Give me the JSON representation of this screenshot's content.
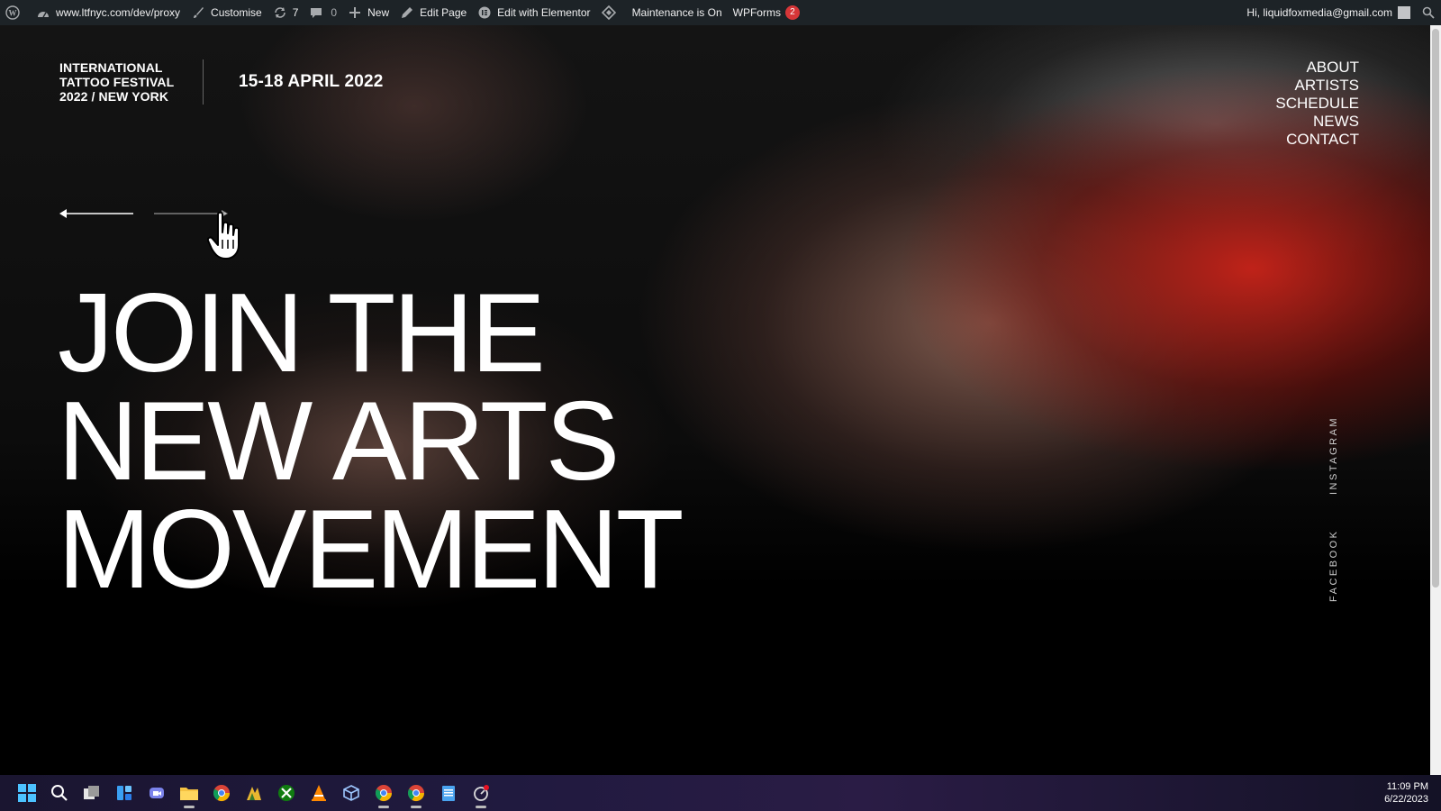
{
  "adminbar": {
    "wp_logo": "wordpress-icon",
    "site_url": "www.ltfnyc.com/dev/proxy",
    "customise": "Customise",
    "updates_count": "7",
    "comments_count": "0",
    "new": "New",
    "edit_page": "Edit Page",
    "edit_elementor": "Edit with Elementor",
    "maintenance": "Maintenance is On",
    "wpforms": "WPForms",
    "wpforms_badge": "2",
    "greeting": "Hi, liquidfoxmedia@gmail.com"
  },
  "site": {
    "logo_lines": [
      "INTERNATIONAL",
      "TATTOO FESTIVAL",
      "2022 / NEW YORK"
    ],
    "dates": "15-18 APRIL 2022",
    "nav": [
      "ABOUT",
      "ARTISTS",
      "SCHEDULE",
      "NEWS",
      "CONTACT"
    ],
    "headline": [
      "JOIN THE",
      "NEW ARTS",
      "MOVEMENT"
    ],
    "social": {
      "instagram": "INSTAGRAM",
      "facebook": "FACEBOOK"
    }
  },
  "taskbar": {
    "icons": [
      "windows-start-icon",
      "search-icon",
      "task-view-icon",
      "widgets-icon",
      "teams-chat-icon",
      "file-explorer-icon",
      "chrome-icon",
      "app-icon",
      "xbox-icon",
      "vlc-icon",
      "box-icon",
      "chrome-icon",
      "chrome-active-icon",
      "notepad-icon",
      "app-notification-icon"
    ],
    "time": "11:09 PM",
    "date": "6/22/2023"
  },
  "colors": {
    "adminbar_bg": "#1d2327",
    "badge": "#d63638",
    "accent_red": "#d0241a"
  }
}
